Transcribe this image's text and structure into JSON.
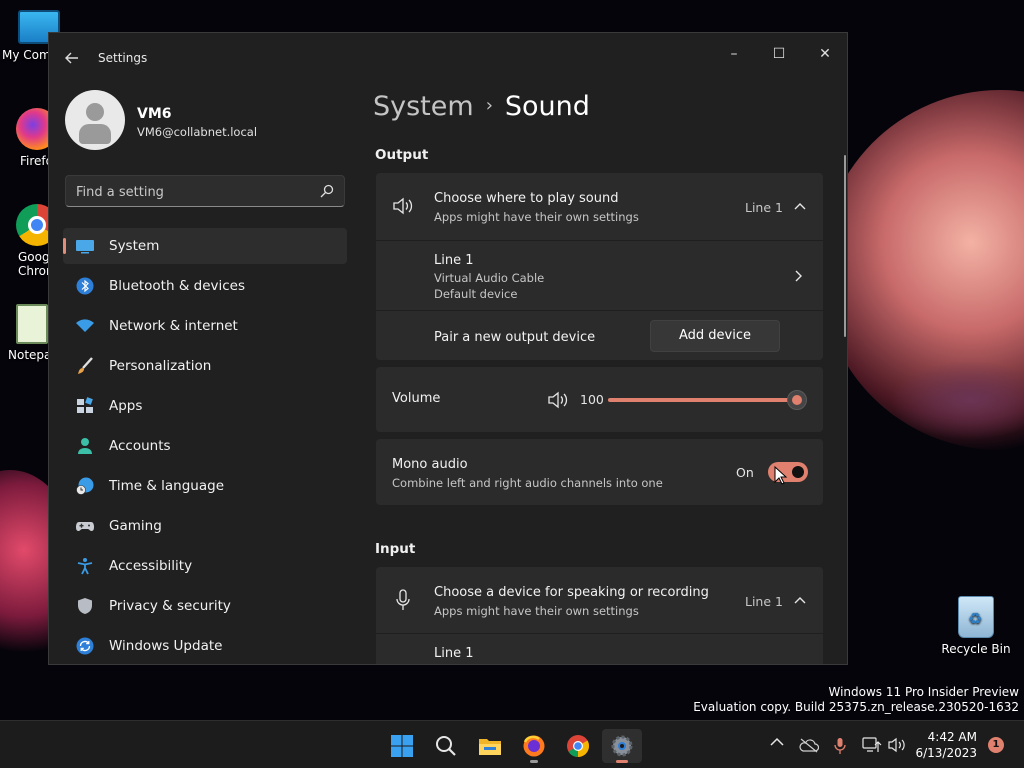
{
  "desktop": {
    "icons": [
      {
        "label": "My Com"
      },
      {
        "label": "Firefo"
      },
      {
        "label": "Goog Chrom"
      },
      {
        "label": "Notepa"
      }
    ],
    "recycle_bin": "Recycle Bin",
    "watermark_line1": "Windows 11 Pro Insider Preview",
    "watermark_line2": "Evaluation copy. Build 25375.zn_release.230520-1632"
  },
  "window": {
    "title": "Settings",
    "minimize_glyph": "–",
    "maximize_glyph": "☐",
    "close_glyph": "✕"
  },
  "profile": {
    "name": "VM6",
    "email": "VM6@collabnet.local"
  },
  "search": {
    "placeholder": "Find a setting"
  },
  "sidebar": {
    "items": [
      {
        "label": "System",
        "icon": "monitor-icon"
      },
      {
        "label": "Bluetooth & devices",
        "icon": "bluetooth-icon"
      },
      {
        "label": "Network & internet",
        "icon": "wifi-icon"
      },
      {
        "label": "Personalization",
        "icon": "brush-icon"
      },
      {
        "label": "Apps",
        "icon": "apps-icon"
      },
      {
        "label": "Accounts",
        "icon": "person-icon"
      },
      {
        "label": "Time & language",
        "icon": "globe-clock-icon"
      },
      {
        "label": "Gaming",
        "icon": "gamepad-icon"
      },
      {
        "label": "Accessibility",
        "icon": "accessibility-icon"
      },
      {
        "label": "Privacy & security",
        "icon": "shield-icon"
      },
      {
        "label": "Windows Update",
        "icon": "update-icon"
      }
    ]
  },
  "breadcrumb": {
    "parent": "System",
    "separator": "›",
    "current": "Sound"
  },
  "output": {
    "section_title": "Output",
    "choose_title": "Choose where to play sound",
    "choose_sub": "Apps might have their own settings",
    "choose_value": "Line 1",
    "device_name": "Line 1",
    "device_desc": "Virtual Audio Cable",
    "device_default": "Default device",
    "pair_label": "Pair a new output device",
    "add_device_button": "Add device"
  },
  "volume": {
    "label": "Volume",
    "value": "100",
    "level_percent": 100
  },
  "mono": {
    "title": "Mono audio",
    "subtitle": "Combine left and right audio channels into one",
    "state_label": "On",
    "on": true
  },
  "input": {
    "section_title": "Input",
    "choose_title": "Choose a device for speaking or recording",
    "choose_sub": "Apps might have their own settings",
    "choose_value": "Line 1",
    "device_name": "Line 1"
  },
  "taskbar": {
    "time": "4:42 AM",
    "date": "6/13/2023",
    "notification_count": "1"
  },
  "colors": {
    "accent": "#e0806e",
    "window_bg": "#202020",
    "card_bg": "#2b2b2b"
  }
}
